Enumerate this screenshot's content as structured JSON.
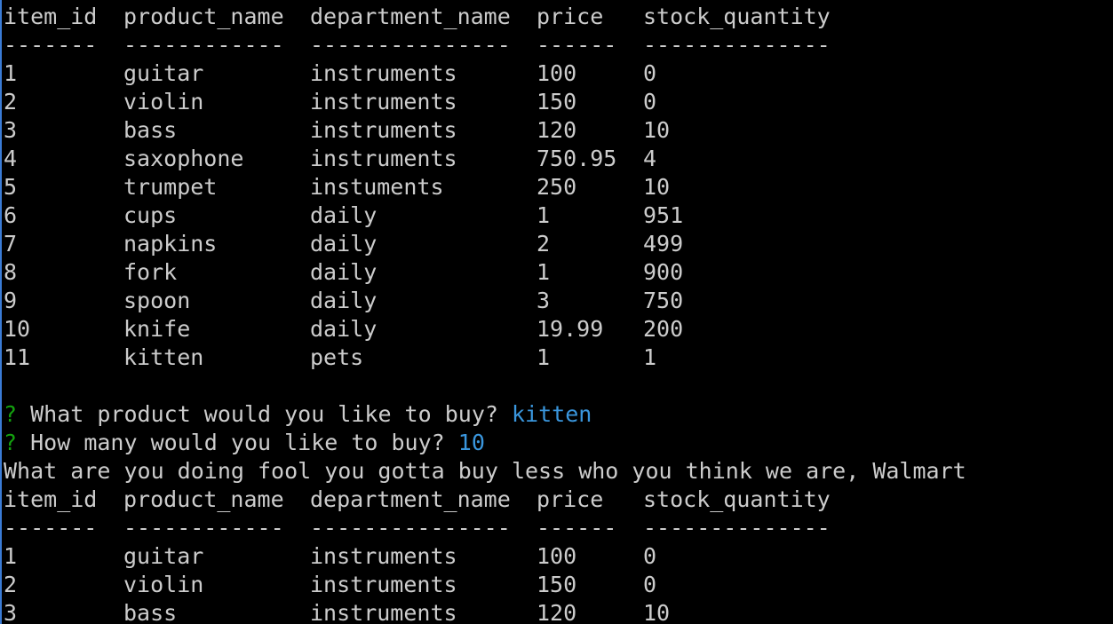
{
  "table1": {
    "headers": [
      "item_id",
      "product_name",
      "department_name",
      "price",
      "stock_quantity"
    ],
    "dashes": [
      "-------",
      "------------",
      "---------------",
      "------",
      "--------------"
    ],
    "rows": [
      [
        "1",
        "guitar",
        "instruments",
        "100",
        "0"
      ],
      [
        "2",
        "violin",
        "instruments",
        "150",
        "0"
      ],
      [
        "3",
        "bass",
        "instruments",
        "120",
        "10"
      ],
      [
        "4",
        "saxophone",
        "instruments",
        "750.95",
        "4"
      ],
      [
        "5",
        "trumpet",
        "instuments",
        "250",
        "10"
      ],
      [
        "6",
        "cups",
        "daily",
        "1",
        "951"
      ],
      [
        "7",
        "napkins",
        "daily",
        "2",
        "499"
      ],
      [
        "8",
        "fork",
        "daily",
        "1",
        "900"
      ],
      [
        "9",
        "spoon",
        "daily",
        "3",
        "750"
      ],
      [
        "10",
        "knife",
        "daily",
        "19.99",
        "200"
      ],
      [
        "11",
        "kitten",
        "pets",
        "1",
        "1"
      ]
    ]
  },
  "prompts": [
    {
      "mark": "?",
      "question": "What product would you like to buy?",
      "answer": "kitten"
    },
    {
      "mark": "?",
      "question": "How many would you like to buy?",
      "answer": "10"
    }
  ],
  "message": "What are you doing fool you gotta buy less who you think we are, Walmart",
  "table2": {
    "headers": [
      "item_id",
      "product_name",
      "department_name",
      "price",
      "stock_quantity"
    ],
    "dashes": [
      "-------",
      "------------",
      "---------------",
      "------",
      "--------------"
    ],
    "rows": [
      [
        "1",
        "guitar",
        "instruments",
        "100",
        "0"
      ],
      [
        "2",
        "violin",
        "instruments",
        "150",
        "0"
      ],
      [
        "3",
        "bass",
        "instruments",
        "120",
        "10"
      ]
    ]
  },
  "colors": {
    "background": "#000000",
    "text": "#cccccc",
    "prompt_mark": "#13a10e",
    "answer": "#3a96dd",
    "window_edge": "#3a7bd5"
  }
}
